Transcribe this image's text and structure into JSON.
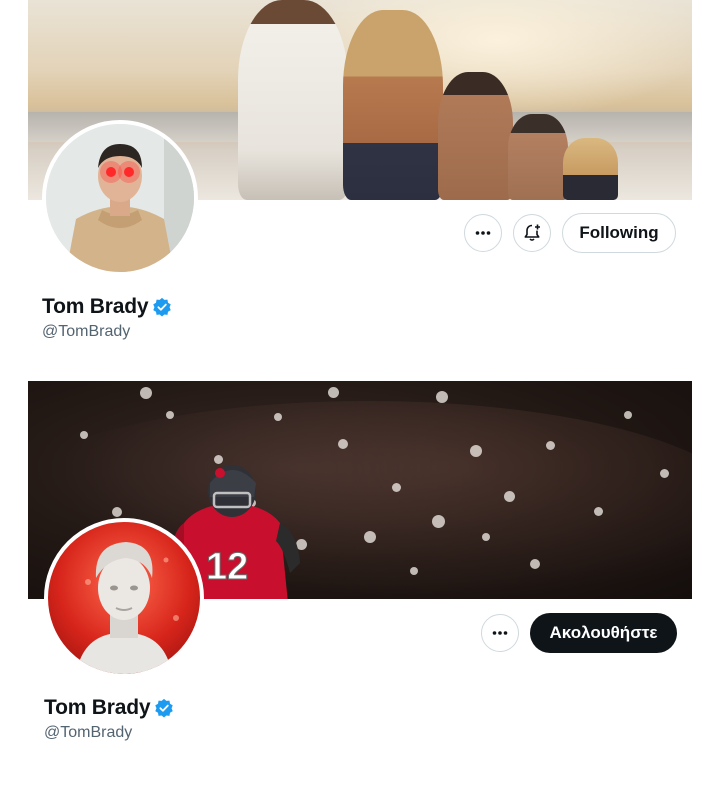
{
  "profiles": [
    {
      "display_name": "Tom Brady",
      "handle": "@TomBrady",
      "verified": true,
      "buttons": {
        "follow_label": "Following"
      },
      "icons": [
        "more-icon",
        "notification-bell-icon",
        "verified-badge-icon"
      ]
    },
    {
      "display_name": "Tom Brady",
      "handle": "@TomBrady",
      "verified": true,
      "buttons": {
        "follow_label": "Ακολουθήστε"
      },
      "jersey_number": "12",
      "icons": [
        "more-icon",
        "verified-badge-icon"
      ]
    }
  ],
  "colors": {
    "verified_blue": "#1d9bf0",
    "follow_dark": "#0f1419",
    "handle_gray": "#536471",
    "border": "#cfd9de"
  }
}
